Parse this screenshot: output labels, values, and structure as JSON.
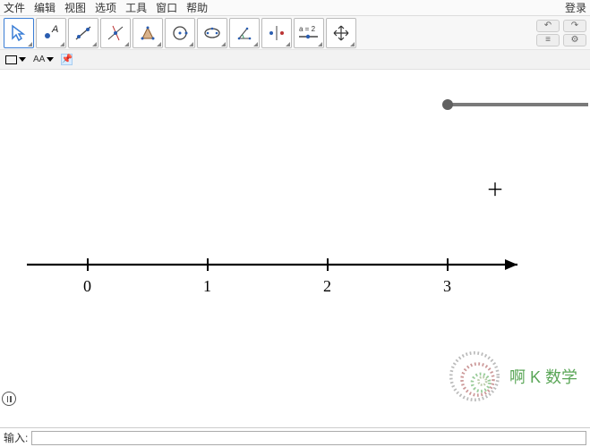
{
  "menubar": {
    "items": [
      "文件",
      "编辑",
      "视图",
      "选项",
      "工具",
      "窗口",
      "帮助"
    ],
    "login": "登录"
  },
  "toolbar": {
    "tools": [
      {
        "name": "move-tool",
        "selected": true
      },
      {
        "name": "point-tool"
      },
      {
        "name": "line-tool"
      },
      {
        "name": "perpendicular-tool"
      },
      {
        "name": "polygon-tool"
      },
      {
        "name": "circle-tool"
      },
      {
        "name": "ellipse-tool"
      },
      {
        "name": "angle-tool"
      },
      {
        "name": "reflect-tool"
      },
      {
        "name": "slider-tool",
        "label": "a = 2"
      },
      {
        "name": "move-view-tool"
      }
    ],
    "undo": "↶",
    "redo": "↷",
    "menu": "≡",
    "settings": "⚙"
  },
  "secondbar": {
    "text_label": "AA",
    "pin": "📌"
  },
  "canvas": {
    "slider": {
      "min_pos": 0
    },
    "axis_labels": [
      "0",
      "1",
      "2",
      "3"
    ]
  },
  "watermark": {
    "text": "啊 K 数学"
  },
  "inputbar": {
    "label": "输入:",
    "value": ""
  },
  "chart_data": {
    "type": "line",
    "title": "",
    "xlabel": "",
    "ylabel": "",
    "x": [
      0,
      1,
      2,
      3
    ],
    "values": [
      0,
      1,
      2,
      3
    ],
    "xlim": [
      -0.5,
      4.0
    ],
    "annotations": [
      "number line with integer ticks 0–3",
      "slider widget top-right"
    ]
  }
}
